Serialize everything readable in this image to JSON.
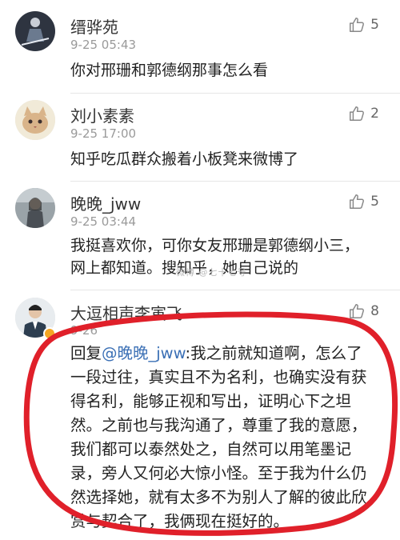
{
  "comments": [
    {
      "name": "缙骅苑",
      "time": "9-25 05:43",
      "text": "你对邢珊和郭德纲那事怎么看",
      "likes": "5",
      "avatar_icon": "skier-avatar-icon"
    },
    {
      "name": "刘小素素",
      "time": "9-25 17:00",
      "text": "知乎吃瓜群众搬着小板凳来微博了",
      "likes": "2",
      "avatar_icon": "cat-avatar-icon"
    },
    {
      "name": "晚晚_jww",
      "time": "9-25 03:44",
      "text_lines": [
        "我挺喜欢你，可你女友邢珊是郭德纲小三，",
        "网上都知道。搜知乎，她自己说的"
      ],
      "likes": "5",
      "avatar_icon": "portrait-avatar-icon"
    },
    {
      "name": "大逗相声李寅飞",
      "time": "9-26",
      "likes": "8",
      "avatar_icon": "man-avatar-icon",
      "verified_badge": "v-badge-icon",
      "reply": {
        "prefix": "回复",
        "mention": "@晚晚_jww",
        "first_line_rest": ":我之前就知道啊，怎么了",
        "lines": [
          "一段过往，真实且不为名利，也确实没有获",
          "得名利，能够正视和写出，证明心下之坦",
          "然。之前也与我沟通了，尊重了我的意愿，",
          "我们都可以泰然处之，自然可以用笔墨记",
          "录，旁人又何必大惊小怪。至于我为什么仍",
          "然选择她，就有太多不为别人了解的彼此欣",
          "赏与契合了，我俩现在挺好的。"
        ]
      }
    }
  ],
  "watermark": "微博 @七十七号",
  "colors": {
    "highlight_circle": "#e0202a",
    "mention": "#3a6fb5",
    "time": "#9a9a9a"
  }
}
